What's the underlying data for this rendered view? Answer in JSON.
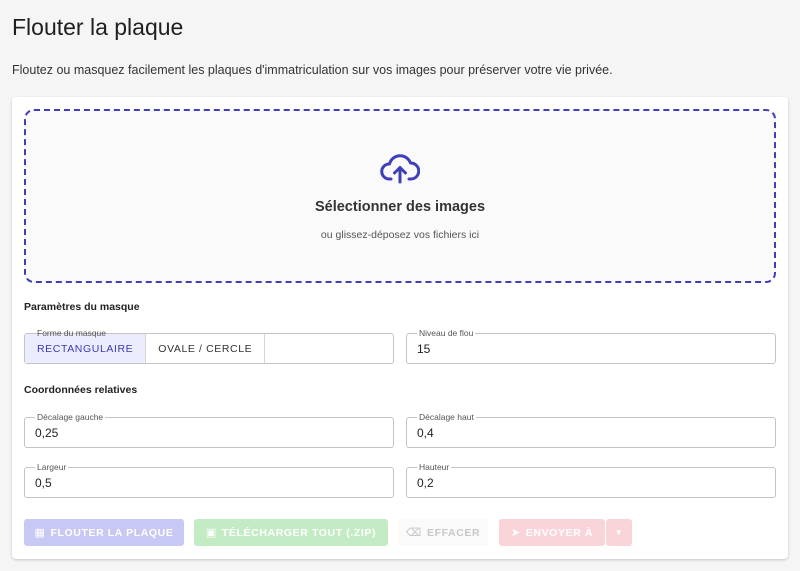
{
  "header": {
    "title": "Flouter la plaque",
    "description": "Floutez ou masquez facilement les plaques d'immatriculation sur vos images pour préserver votre vie privée."
  },
  "dropzone": {
    "title": "Sélectionner des images",
    "subtitle": "ou glissez-déposez vos fichiers ici",
    "icon": "cloud-upload-icon"
  },
  "mask_params": {
    "section_label": "Paramètres du masque",
    "shape": {
      "label": "Forme du masque",
      "options": [
        "RECTANGULAIRE",
        "OVALE / CERCLE"
      ],
      "selected": "RECTANGULAIRE"
    },
    "blur_level": {
      "label": "Niveau de flou",
      "value": "15"
    }
  },
  "coords": {
    "section_label": "Coordonnées relatives",
    "left_offset": {
      "label": "Décalage gauche",
      "value": "0,25"
    },
    "top_offset": {
      "label": "Décalage haut",
      "value": "0,4"
    },
    "width": {
      "label": "Largeur",
      "value": "0,5"
    },
    "height": {
      "label": "Hauteur",
      "value": "0,2"
    }
  },
  "actions": {
    "blur": "FLOUTER LA PLAQUE",
    "download": "TÉLÉCHARGER TOUT (.ZIP)",
    "clear": "EFFACER",
    "send": "ENVOYER À"
  },
  "colors": {
    "accent": "#3f3fb8",
    "primary_disabled": "#c8c8f4",
    "success_disabled": "#c4ecc4",
    "danger_disabled": "#f9d5da"
  }
}
